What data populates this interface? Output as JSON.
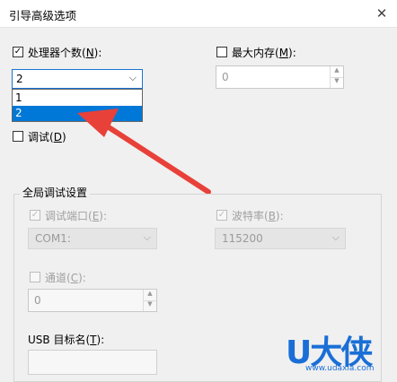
{
  "window": {
    "title": "引导高级选项",
    "close_glyph": "✕"
  },
  "processors": {
    "label_prefix": "处理器个数(",
    "label_key": "N",
    "label_suffix": "):",
    "checked": true,
    "value": "2",
    "options": [
      "1",
      "2"
    ],
    "selected_option": "2"
  },
  "max_memory": {
    "label_prefix": "最大内存(",
    "label_key": "M",
    "label_suffix": "):",
    "checked": false,
    "value": "0"
  },
  "debug": {
    "label_prefix": "调试(",
    "label_key": "D",
    "label_suffix": ")",
    "checked": false
  },
  "global_debug": {
    "group_title": "全局调试设置",
    "debug_port": {
      "label_prefix": "调试端口(",
      "label_key": "E",
      "label_suffix": "):",
      "checked": true,
      "value": "COM1:"
    },
    "baud_rate": {
      "label_prefix": "波特率(",
      "label_key": "B",
      "label_suffix": "):",
      "checked": true,
      "value": "115200"
    },
    "channel": {
      "label_prefix": "通道(",
      "label_key": "C",
      "label_suffix": "):",
      "checked": false,
      "value": "0"
    },
    "usb_target": {
      "label_prefix": "USB 目标名(",
      "label_key": "T",
      "label_suffix": "):",
      "value": ""
    }
  },
  "watermark": {
    "logo": "U大侠",
    "url": "www.udaxia.com"
  },
  "colors": {
    "accent": "#0078d7",
    "arrow": "#e8413a",
    "watermark": "#1a6fd6"
  }
}
